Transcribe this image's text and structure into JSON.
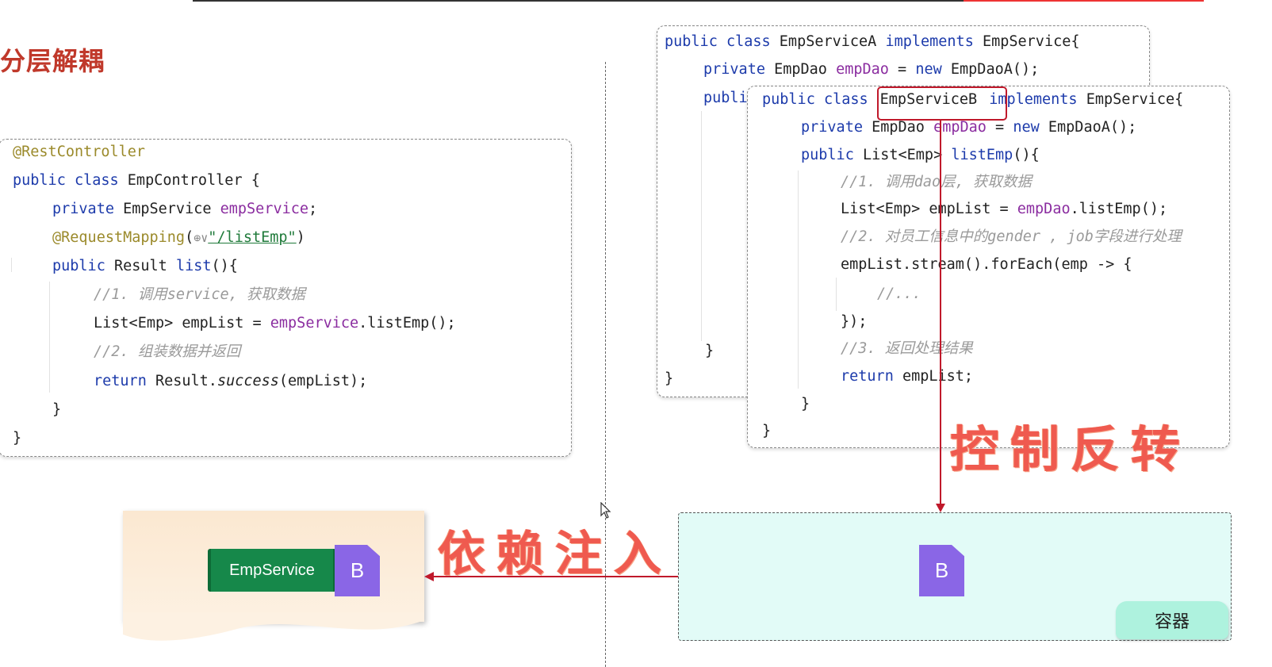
{
  "title": "分层解耦",
  "controller_code": {
    "l1": "@RestController",
    "l2_kw1": "public class",
    "l2_rest": " EmpController {",
    "l3_kw": "private",
    "l3_type": " EmpService ",
    "l3_field": "empService",
    "l3_end": ";",
    "l4_anno": "@RequestMapping",
    "l4_paren": "(",
    "l4_icon": "⊕∨",
    "l4_str": "\"/listEmp\"",
    "l4_end": ")",
    "l5_kw": "public",
    "l5_type": " Result ",
    "l5_fn": "list",
    "l5_end": "(){",
    "l6": "//1. 调用service, 获取数据",
    "l7_a": "List<Emp> empList = ",
    "l7_field": "empService",
    "l7_b": ".listEmp();",
    "l8": "//2. 组装数据并返回",
    "l9_kw": "return",
    "l9_a": " Result.",
    "l9_it": "success",
    "l9_b": "(empList);",
    "l10": "}",
    "l11": "}"
  },
  "serviceA_code": {
    "l1_kw1": "public class",
    "l1_name": " EmpServiceA ",
    "l1_kw2": "implements",
    "l1_rest": " EmpService{",
    "l2_kw": "private",
    "l2_type": " EmpDao ",
    "l2_field": "empDao",
    "l2_eq": " = ",
    "l2_kw2": "new",
    "l2_rest": " EmpDaoA();",
    "l3": "publi",
    "l4": "}",
    "l5": "}"
  },
  "serviceB_code": {
    "l1_kw1": "public class",
    "l1_name": "EmpServiceB",
    "l1_kw2": "implements",
    "l1_rest": " EmpService{",
    "l2_kw": "private",
    "l2_type": " EmpDao ",
    "l2_field": "empDao",
    "l2_eq": " = ",
    "l2_kw2": "new",
    "l2_rest": " EmpDaoA();",
    "l3_kw": "public",
    "l3_type": " List<Emp> ",
    "l3_fn": "listEmp",
    "l3_end": "(){",
    "l4": "//1. 调用dao层, 获取数据",
    "l5_a": "List<Emp> empList = ",
    "l5_field": "empDao",
    "l5_b": ".listEmp();",
    "l6": "//2. 对员工信息中的gender , job字段进行处理",
    "l7": "empList.stream().forEach(emp -> {",
    "l8": "//...",
    "l9": "});",
    "l10": "//3. 返回处理结果",
    "l11_kw": "return",
    "l11_rest": " empList;",
    "l12": "}",
    "l13": "}"
  },
  "labels": {
    "ioc": "控制反转",
    "di": "依赖注入",
    "empservice": "EmpService",
    "bean_left": "B",
    "bean_right": "B",
    "container": "容器"
  },
  "colors": {
    "keyword": "#1d3bab",
    "field": "#8b2da0",
    "annotation": "#9b8a2b",
    "comment": "#9a9a9a",
    "arrow": "#c0192b",
    "title": "#c0392b",
    "bean": "#8a66e6",
    "empservice_badge": "#16884a",
    "container_bg": "#e2fbf7",
    "container_tab": "#aef2de"
  },
  "icons": [
    "globe-icon",
    "mouse-cursor-icon",
    "document-bean-icon"
  ]
}
